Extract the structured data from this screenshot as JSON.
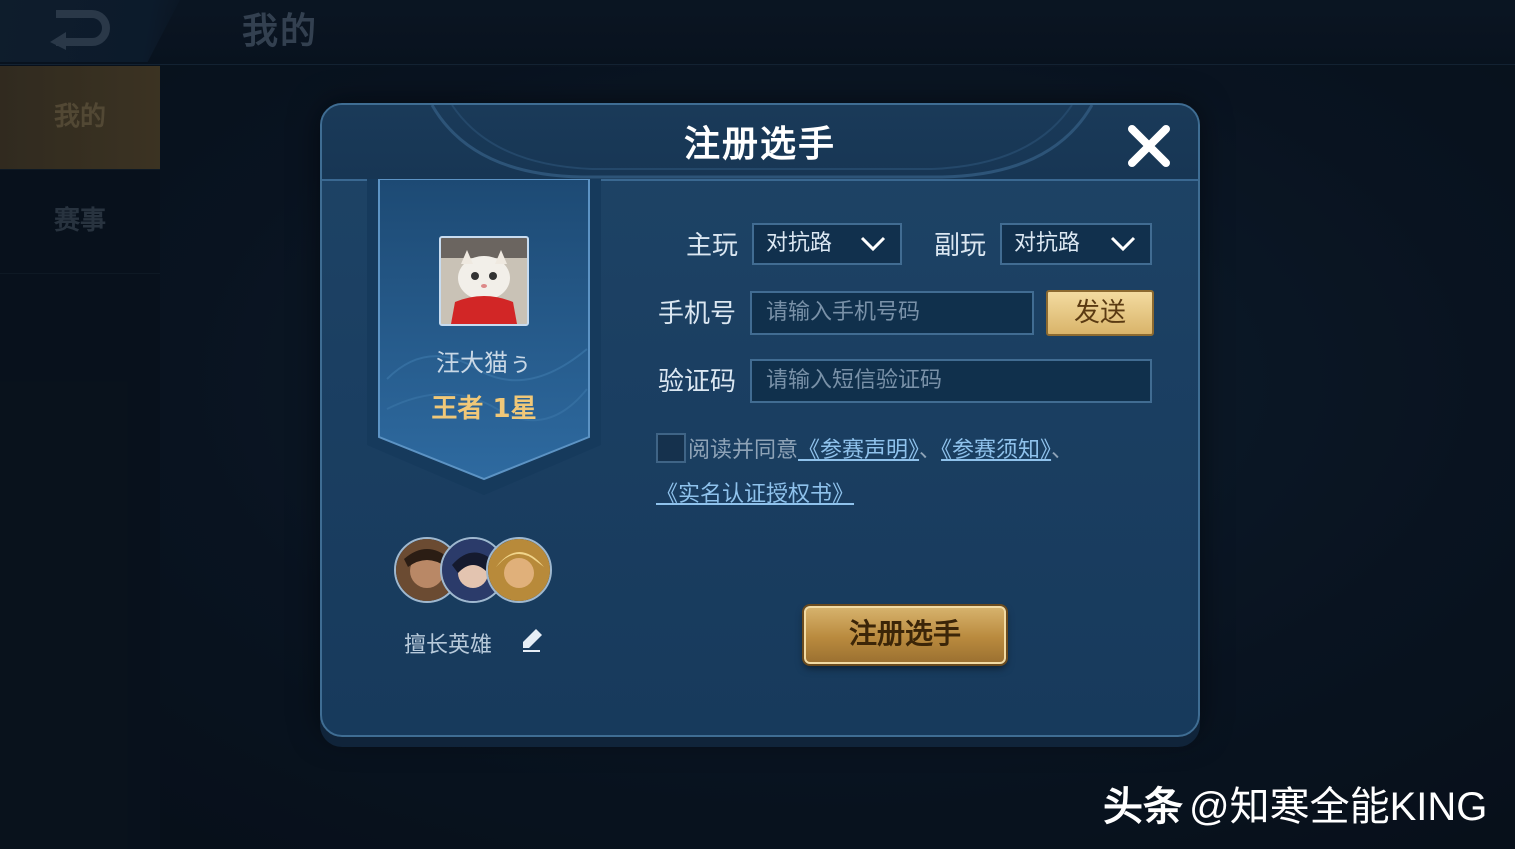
{
  "topbar": {
    "title": "我的"
  },
  "sidebar": {
    "items": [
      {
        "label": "我的",
        "active": true
      },
      {
        "label": "赛事",
        "active": false
      }
    ]
  },
  "dialog": {
    "title": "注册选手",
    "profile": {
      "name": "汪大猫ぅ",
      "rank": "王者 1星",
      "skilled_heroes_label": "擅长英雄"
    },
    "form": {
      "main_role_label": "主玩",
      "main_role_value": "对抗路",
      "sub_role_label": "副玩",
      "sub_role_value": "对抗路",
      "phone_label": "手机号",
      "phone_placeholder": "请输入手机号码",
      "send_label": "发送",
      "code_label": "验证码",
      "code_placeholder": "请输入短信验证码",
      "agree_text": "阅读并同意",
      "link1": "《参赛声明》",
      "sep1": "、",
      "link2": "《参赛须知》",
      "sep2": "、",
      "link3": "《实名认证授权书》"
    },
    "register_label": "注册选手"
  },
  "watermark": {
    "brand": "头条",
    "handle": "@知寒全能KING"
  },
  "colors": {
    "accent_gold": "#d9b46a",
    "link_blue": "#8fc2ec",
    "panel_blue": "#1b3f62"
  }
}
